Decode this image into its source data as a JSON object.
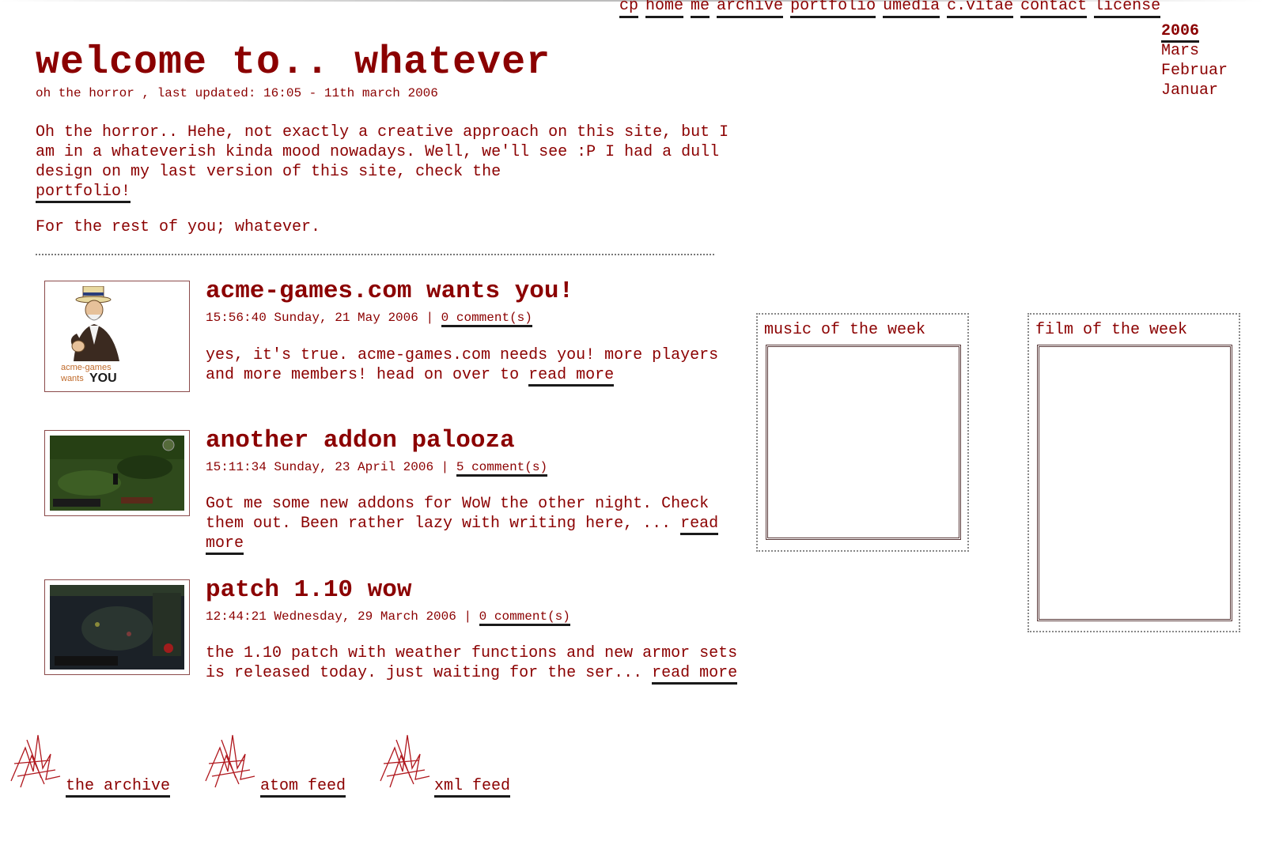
{
  "nav": [
    "cp",
    "home",
    "me",
    "archive",
    "portfolio",
    "umedia",
    "c.vitae",
    "contact",
    "license"
  ],
  "years": {
    "year": "2006",
    "months": [
      "Mars",
      "Februar",
      "Januar"
    ]
  },
  "header": {
    "title": "welcome to.. whatever",
    "subtitle": "oh the horror , last updated: 16:05 - 11th march 2006"
  },
  "intro": {
    "p1": "Oh the horror.. Hehe, not exactly a creative approach on this site, but I am in a whateverish kinda mood nowadays. Well, we'll see :P I had a dull design on my last version of this site, check the",
    "p1_link": "portfolio!",
    "p2": "For the rest of you; whatever."
  },
  "posts": [
    {
      "title": "acme-games.com wants you!",
      "meta": "15:56:40 Sunday, 21 May 2006 | ",
      "comments": "0 comment(s)",
      "body": "yes, it's true. acme-games.com needs you! more players and more members! head on over to ",
      "read_more": "read more",
      "thumb_text_1": "acme-games",
      "thumb_text_2": "wants",
      "thumb_text_3": "YOU"
    },
    {
      "title": "another addon palooza",
      "meta": "15:11:34 Sunday, 23 April 2006 | ",
      "comments": "5 comment(s)",
      "body": "Got me some new addons for WoW the other night. Check them out. Been rather lazy with writing here, ... ",
      "read_more": "read more"
    },
    {
      "title": "patch 1.10 wow",
      "meta": "12:44:21 Wednesday, 29 March 2006 | ",
      "comments": "0 comment(s)",
      "body": "the 1.10 patch with weather functions and new armor sets is released today. just waiting for the ser... ",
      "read_more": "read more"
    }
  ],
  "sidebar": {
    "music_title": "music of the week",
    "film_title": "film of the week"
  },
  "footer": [
    "the archive",
    "atom feed",
    "xml feed"
  ],
  "colors": {
    "text": "#8b0000",
    "underline": "#1a1a1a",
    "background": "#ffffff"
  }
}
